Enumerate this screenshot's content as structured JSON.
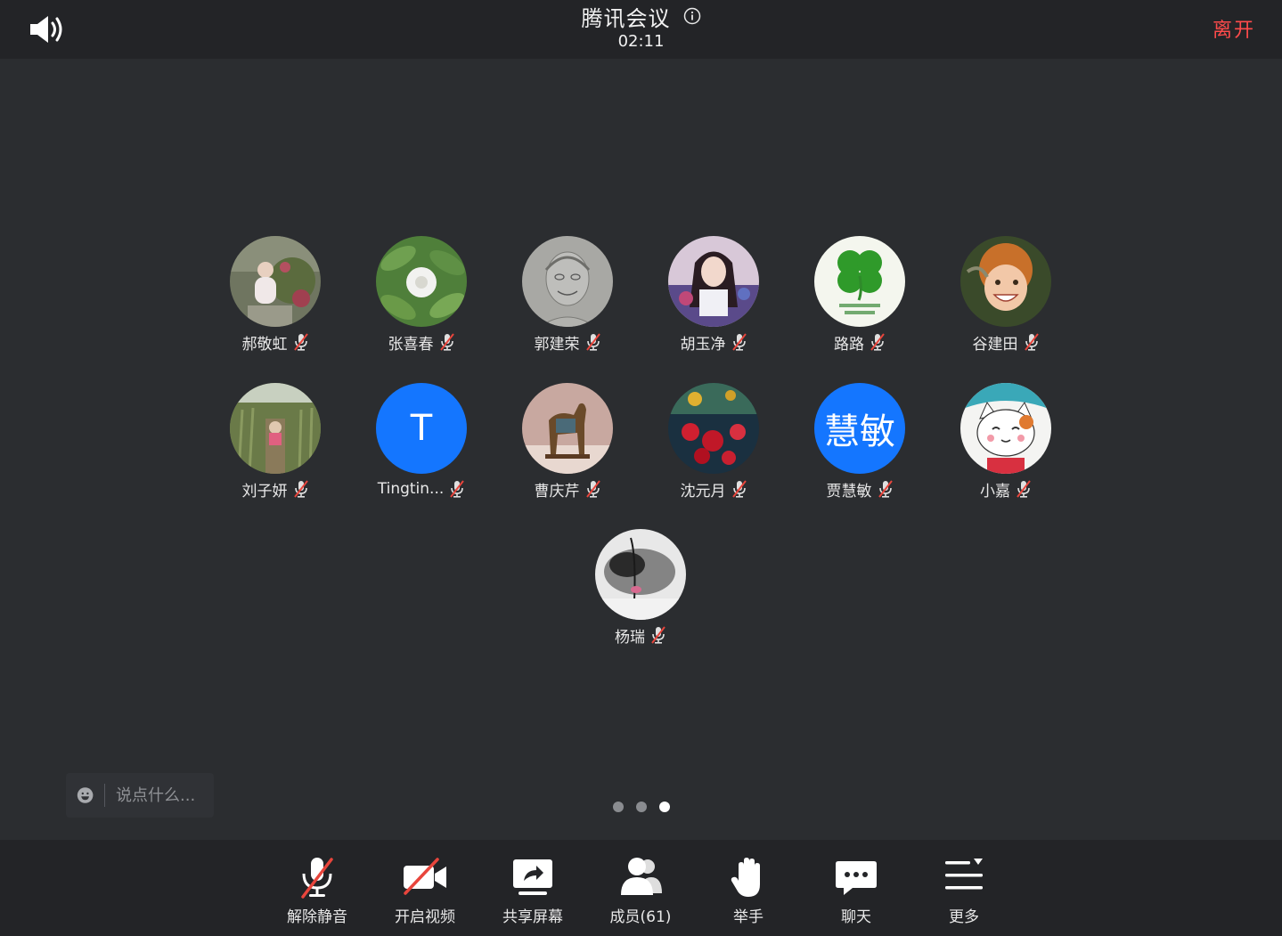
{
  "header": {
    "title": "腾讯会议",
    "timer": "02:11",
    "leave_label": "离开"
  },
  "participants": [
    {
      "name": "郝敬虹",
      "avatar": "photo-child-flowers"
    },
    {
      "name": "张喜春",
      "avatar": "photo-dandelion"
    },
    {
      "name": "郭建荣",
      "avatar": "photo-sketch-portrait"
    },
    {
      "name": "胡玉净",
      "avatar": "photo-woman"
    },
    {
      "name": "路路",
      "avatar": "photo-clover"
    },
    {
      "name": "谷建田",
      "avatar": "photo-boy-smiling"
    },
    {
      "name": "刘子妍",
      "avatar": "photo-grass-field"
    },
    {
      "name": "Tingtin...",
      "avatar_letter": "T"
    },
    {
      "name": "曹庆芹",
      "avatar": "photo-horse-statue"
    },
    {
      "name": "沈元月",
      "avatar": "photo-red-flowers"
    },
    {
      "name": "贾慧敏",
      "avatar_letter": "慧敏"
    },
    {
      "name": "小嘉",
      "avatar": "photo-lucky-cat"
    },
    {
      "name": "杨瑞",
      "avatar": "photo-ink-painting"
    }
  ],
  "chat": {
    "placeholder": "说点什么..."
  },
  "pager": {
    "pages": 3,
    "active": 3
  },
  "toolbar": {
    "unmute": "解除静音",
    "video": "开启视频",
    "share": "共享屏幕",
    "members": "成员(61)",
    "raise_hand": "举手",
    "chat": "聊天",
    "more": "更多"
  },
  "colors": {
    "background": "#2b2d30",
    "bar": "#232427",
    "leave": "#ff4b4b",
    "avatar_blue": "#1476ff",
    "mute_red": "#e8453c"
  }
}
